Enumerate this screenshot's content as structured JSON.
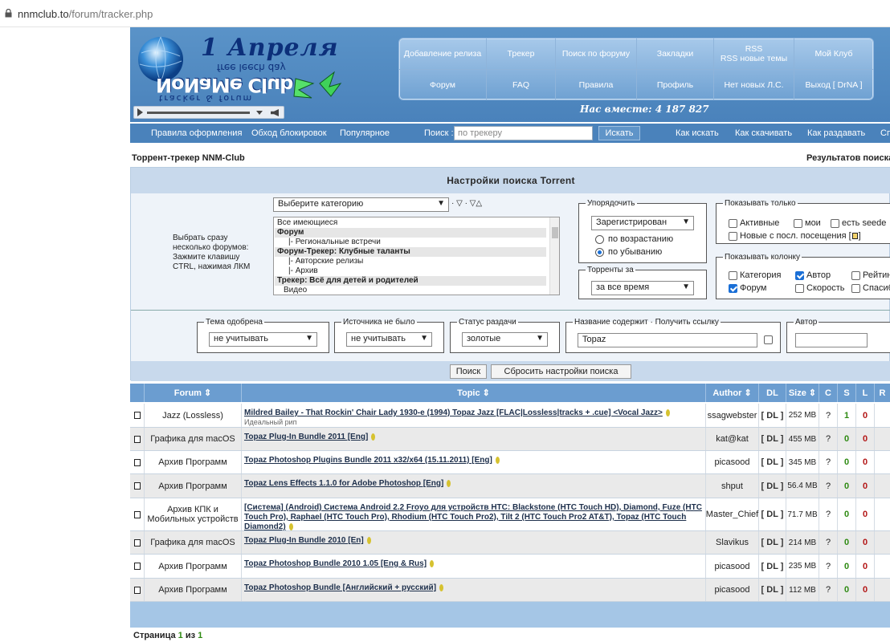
{
  "browser": {
    "url_host": "nnmclub.to",
    "url_path": "/forum/tracker.php"
  },
  "header": {
    "logo_text": "NoNaMe Club",
    "logo_date": "1 Апреля",
    "logo_sub1": "free leech day",
    "logo_sub2": "tracker & forum",
    "together_label": "Нас вместе: 4 187 827",
    "menu_row1": [
      "Добавление релиза",
      "Трекер",
      "Поиск по форуму",
      "Закладки",
      "RSS\nRSS новые темы",
      "Мой Клуб"
    ],
    "menu_row2": [
      "Форум",
      "FAQ",
      "Правила",
      "Профиль",
      "Нет новых Л.С.",
      "Выход [ DrNA ]"
    ]
  },
  "navbar": {
    "links_left": [
      "Правила оформления",
      "Обход блокировок",
      "Популярное"
    ],
    "search_label": "Поиск :",
    "search_placeholder": "по трекеру",
    "search_button": "Искать",
    "links_right": [
      "Как искать",
      "Как скачивать",
      "Как раздавать",
      "Сп"
    ]
  },
  "toprow": {
    "left": "Торрент-трекер NNM-Club",
    "right": "Результатов поиска"
  },
  "panel": {
    "title": "Настройки поиска Torrent",
    "hint": "Выбрать сразу несколько форумов: Зажмите клавишу CTRL, нажимая ЛКМ",
    "category_select": "Выберите категорию",
    "category_icons": "· ▽ · ▽△",
    "category_list": [
      {
        "text": "Все имеющиеся",
        "group": false
      },
      {
        "text": "Форум",
        "group": true
      },
      {
        "text": "|- Региональные встречи",
        "group": false
      },
      {
        "text": "Форум-Трекер: Клубные таланты",
        "group": true
      },
      {
        "text": "|- Авторские релизы",
        "group": false
      },
      {
        "text": "|- Архив",
        "group": false
      },
      {
        "text": "Трекер: Всё для детей и родителей",
        "group": true
      },
      {
        "text": "Видео",
        "group": false
      }
    ],
    "order": {
      "legend": "Упорядочить",
      "select": "Зарегистрирован",
      "asc_label": "по возрастанию",
      "desc_label": "по убыванию",
      "selected": "desc"
    },
    "period": {
      "legend": "Торренты за",
      "select": "за все время"
    },
    "show_only": {
      "legend": "Показывать только",
      "items": [
        {
          "label": "Активные",
          "checked": false
        },
        {
          "label": "мои",
          "checked": false
        },
        {
          "label": "есть seede",
          "checked": false
        },
        {
          "label": "Новые с посл. посещения [",
          "checked": false
        }
      ],
      "new_tail": "]"
    },
    "show_cols": {
      "legend": "Показывать колонку",
      "items": [
        {
          "label": "Категория",
          "checked": false
        },
        {
          "label": "Автор",
          "checked": true
        },
        {
          "label": "Рейтин",
          "checked": false
        },
        {
          "label": "Форум",
          "checked": true
        },
        {
          "label": "Скорость",
          "checked": false
        },
        {
          "label": "Спасиб",
          "checked": false
        }
      ]
    },
    "approved": {
      "legend": "Тема одобрена",
      "select": "не учитывать"
    },
    "source": {
      "legend": "Источника не было",
      "select": "не учитывать"
    },
    "status": {
      "legend": "Статус раздачи",
      "select": "золотые"
    },
    "title_filter": {
      "legend": "Название содержит",
      "link": "· Получить ссылку",
      "value": "Topaz"
    },
    "author": {
      "legend": "Автор",
      "value": ""
    },
    "search_button": "Поиск",
    "reset_button": "Сбросить настройки поиска"
  },
  "table": {
    "headers": [
      "Forum",
      "Topic",
      "Author",
      "DL",
      "Size",
      "C",
      "S",
      "L",
      "R"
    ],
    "rows": [
      {
        "forum": "Jazz (Lossless)",
        "topic": "Mildred Bailey - That Rockin' Chair Lady 1930-e (1994) Topaz Jazz [FLAC|Lossless|tracks + .cue] <Vocal Jazz>",
        "sub": "Идеальный рип",
        "author": "ssagwebster",
        "dl": "[ DL ]",
        "size": "252 MB",
        "c": "?",
        "s": "1",
        "l": "0"
      },
      {
        "forum": "Графика для macOS",
        "topic": "Topaz Plug-In Bundle 2011 [Eng]",
        "sub": "",
        "author": "kat@kat",
        "dl": "[ DL ]",
        "size": "455 MB",
        "c": "?",
        "s": "0",
        "l": "0"
      },
      {
        "forum": "Архив Программ",
        "topic": "Topaz Photoshop Plugins Bundle 2011 x32/x64 (15.11.2011) [Eng]",
        "sub": "",
        "author": "picasood",
        "dl": "[ DL ]",
        "size": "345 MB",
        "c": "?",
        "s": "0",
        "l": "0"
      },
      {
        "forum": "Архив Программ",
        "topic": "Topaz Lens Effects 1.1.0 for Adobe Photoshop [Eng]",
        "sub": "",
        "author": "shput",
        "dl": "[ DL ]",
        "size": "56.4 MB",
        "c": "?",
        "s": "0",
        "l": "0"
      },
      {
        "forum": "Архив КПК и Мобильных устройств",
        "topic": "[Система] (Android) Система Android 2.2 Froyo для устройств HTC: Blackstone (HTC Touch HD), Diamond, Fuze (HTC Touch Pro), Raphael (HTC Touch Pro), Rhodium (HTC Touch Pro2), Tilt 2 (HTC Touch Pro2 AT&T), Topaz (HTC Touch Diamond2)",
        "sub": "",
        "author": "Master_Chief",
        "dl": "[ DL ]",
        "size": "71.7 MB",
        "c": "?",
        "s": "0",
        "l": "0"
      },
      {
        "forum": "Графика для macOS",
        "topic": "Topaz Plug-In Bundle 2010 [En]",
        "sub": "",
        "author": "Slavikus",
        "dl": "[ DL ]",
        "size": "214 MB",
        "c": "?",
        "s": "0",
        "l": "0"
      },
      {
        "forum": "Архив Программ",
        "topic": "Topaz Photoshop Bundle 2010 1.05 [Eng & Rus]",
        "sub": "",
        "author": "picasood",
        "dl": "[ DL ]",
        "size": "235 MB",
        "c": "?",
        "s": "0",
        "l": "0"
      },
      {
        "forum": "Архив Программ",
        "topic": "Topaz Photoshop Bundle [Английский + русский]",
        "sub": "",
        "author": "picasood",
        "dl": "[ DL ]",
        "size": "112 MB",
        "c": "?",
        "s": "0",
        "l": "0"
      }
    ]
  },
  "pager": {
    "label": "Страница",
    "current": "1",
    "of": "из",
    "total": "1"
  },
  "colors": {
    "header_blue": "#4a82bb",
    "menu_blue": "#6fa1d2",
    "th_blue": "#6b9dd0",
    "seed_green": "#2e8a12",
    "leech_red": "#b31616"
  }
}
